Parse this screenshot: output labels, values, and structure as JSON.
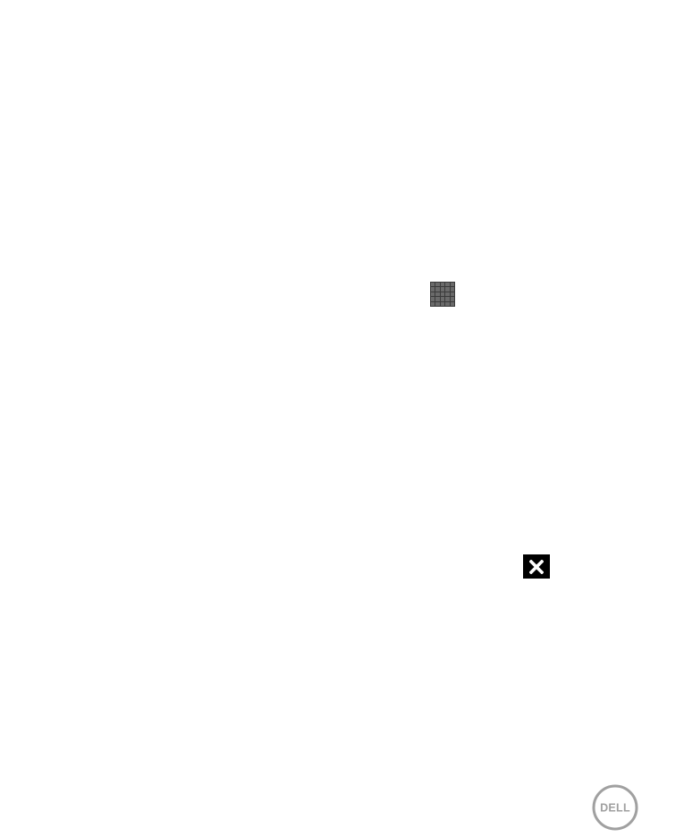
{
  "icons": {
    "grid": "apps-grid-icon",
    "close": "close-icon",
    "logo": "dell-logo"
  },
  "logo": {
    "text": "DELL"
  },
  "colors": {
    "background": "#ffffff",
    "grid_icon": "#3a3a3a",
    "close_icon_bg": "#000000",
    "logo_gray": "#a0a0a0"
  }
}
